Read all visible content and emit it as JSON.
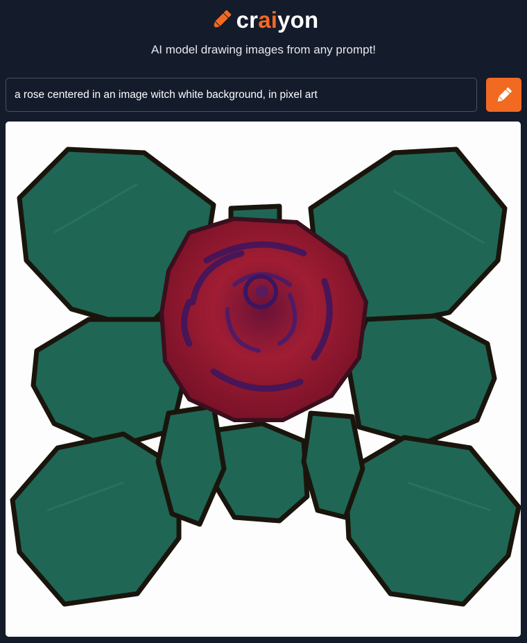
{
  "header": {
    "logo": {
      "part1": "cr",
      "part2": "ai",
      "part3": "yon",
      "icon": "pencil-icon"
    },
    "tagline": "AI model drawing images from any prompt!"
  },
  "prompt": {
    "value": "a rose centered in an image witch white background, in pixel art",
    "button_icon": "pencil-icon"
  },
  "result": {
    "description_icon": "generated-rose-image"
  },
  "colors": {
    "background": "#141b2b",
    "accent": "#f26a22",
    "leaf": "#1f6655",
    "rose": "#8f1530"
  }
}
